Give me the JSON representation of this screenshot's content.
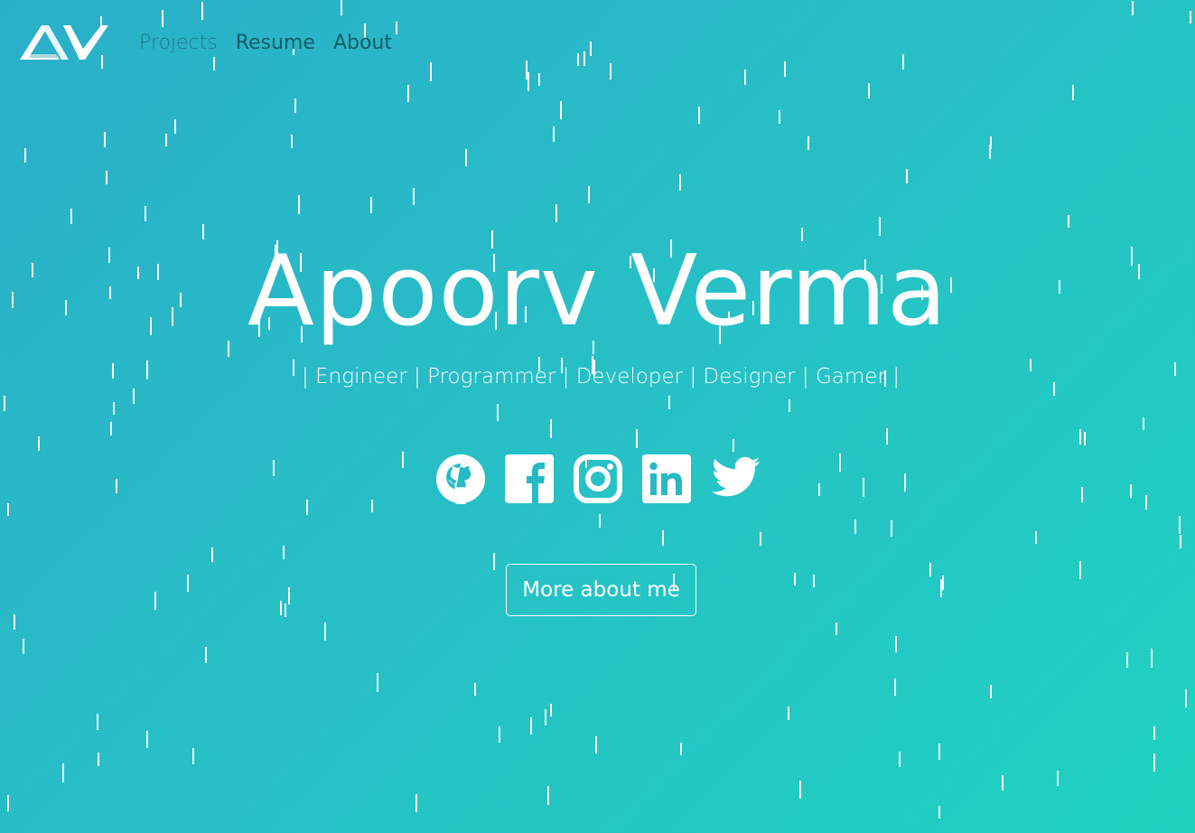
{
  "nav": {
    "items": [
      {
        "label": "Projects"
      },
      {
        "label": "Resume"
      },
      {
        "label": "About"
      }
    ]
  },
  "hero": {
    "name": "Apoorv Verma",
    "tagline": "| Engineer | Programmer | Developer | Designer | Gamer |",
    "cta_label": "More about me"
  },
  "socials": [
    {
      "icon": "github-icon"
    },
    {
      "icon": "facebook-icon"
    },
    {
      "icon": "instagram-icon"
    },
    {
      "icon": "linkedin-icon"
    },
    {
      "icon": "twitter-icon"
    }
  ],
  "colors": {
    "background_start": "#2aafc9",
    "background_end": "#1fd2c0",
    "text": "#ffffff",
    "nav_text": "#155e66"
  }
}
